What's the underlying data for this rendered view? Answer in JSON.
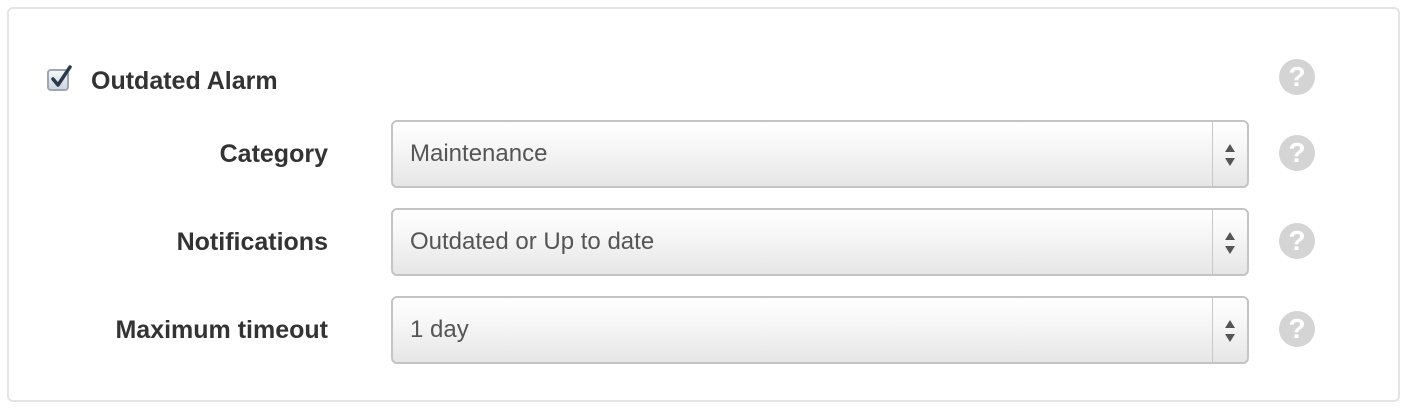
{
  "alarm": {
    "enabled": true,
    "label": "Outdated Alarm",
    "help_glyph": "?"
  },
  "fields": [
    {
      "label": "Category",
      "value": "Maintenance",
      "help_glyph": "?"
    },
    {
      "label": "Notifications",
      "value": "Outdated or Up to date",
      "help_glyph": "?"
    },
    {
      "label": "Maximum timeout",
      "value": "1 day",
      "help_glyph": "?"
    }
  ],
  "icons": {
    "checkbox": "checkmark-icon",
    "select_arrows": "sort-arrows-icon",
    "help": "help-circle-icon"
  }
}
